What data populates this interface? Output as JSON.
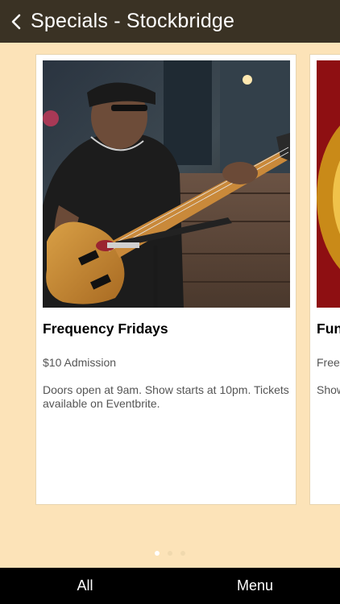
{
  "header": {
    "back_icon": "chevron-left-icon",
    "title": "Specials - Stockbridge"
  },
  "cards": [
    {
      "title": "Frequency Fridays",
      "price": "$10 Admission",
      "description": "Doors open at 9am. Show starts at 10pm. Tickets available on Eventbrite."
    },
    {
      "title": "Fun",
      "price": "Free",
      "description": "Show"
    }
  ],
  "pagination": {
    "total": 3,
    "active": 1
  },
  "tabbar": {
    "all_label": "All",
    "menu_label": "Menu"
  },
  "colors": {
    "header_bg": "#3a3224",
    "page_bg": "#fce3b8",
    "tabbar_bg": "#000000"
  }
}
